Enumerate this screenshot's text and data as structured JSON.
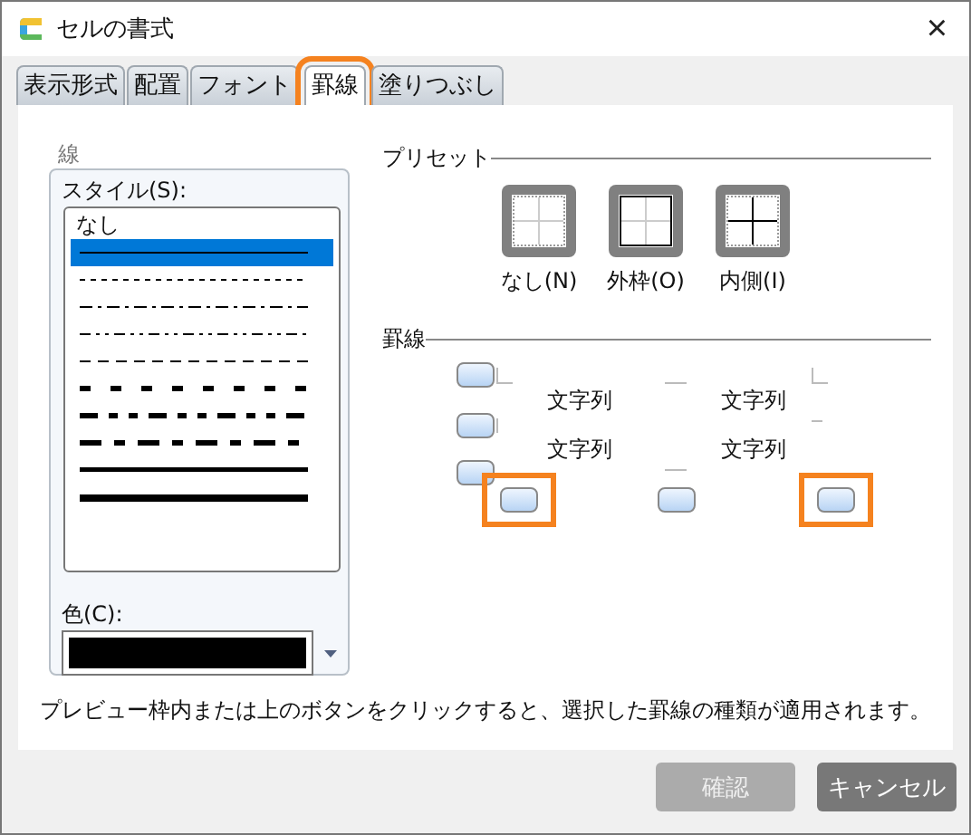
{
  "window": {
    "title": "セルの書式",
    "close": "×"
  },
  "tabs": [
    {
      "label": "表示形式",
      "selected": false,
      "highlighted": false
    },
    {
      "label": "配置",
      "selected": false,
      "highlighted": false
    },
    {
      "label": "フォント",
      "selected": false,
      "highlighted": false
    },
    {
      "label": "罫線",
      "selected": true,
      "highlighted": true
    },
    {
      "label": "塗りつぶし",
      "selected": false,
      "highlighted": false
    }
  ],
  "line": {
    "title": "線",
    "style_label": "スタイル(S):",
    "styles": [
      {
        "kind": "none",
        "label": "なし",
        "selected": false
      },
      {
        "kind": "thin",
        "selected": true
      },
      {
        "kind": "hair-dotted",
        "selected": false
      },
      {
        "kind": "dash-dot",
        "selected": false
      },
      {
        "kind": "dash-dot-dot",
        "selected": false
      },
      {
        "kind": "dashed",
        "selected": false
      },
      {
        "kind": "medium-dashed",
        "selected": false
      },
      {
        "kind": "medium-dash-dot-dot",
        "selected": false
      },
      {
        "kind": "medium-dash-dot",
        "selected": false
      },
      {
        "kind": "medium",
        "selected": false
      },
      {
        "kind": "thick",
        "selected": false
      }
    ],
    "color_label": "色(C):",
    "color": "#000000"
  },
  "presets": {
    "title": "プリセット",
    "items": [
      {
        "kind": "none",
        "label": "なし(N)"
      },
      {
        "kind": "outline",
        "label": "外枠(O)"
      },
      {
        "kind": "inside",
        "label": "内側(I)"
      }
    ]
  },
  "borders": {
    "title": "罫線",
    "buttons": [
      {
        "kind": "top",
        "highlighted": false
      },
      {
        "kind": "middle-horizontal",
        "highlighted": false
      },
      {
        "kind": "bottom",
        "highlighted": false
      },
      {
        "kind": "left",
        "highlighted": true
      },
      {
        "kind": "middle-vertical",
        "highlighted": false
      },
      {
        "kind": "right",
        "highlighted": true
      }
    ],
    "cells": [
      "文字列",
      "文字列",
      "文字列",
      "文字列"
    ]
  },
  "hint": "プレビュー枠内または上のボタンをクリックすると、選択した罫線の種類が適用されます。",
  "buttons": [
    {
      "label": "確認",
      "disabled": true
    },
    {
      "label": "キャンセル",
      "disabled": false
    }
  ]
}
